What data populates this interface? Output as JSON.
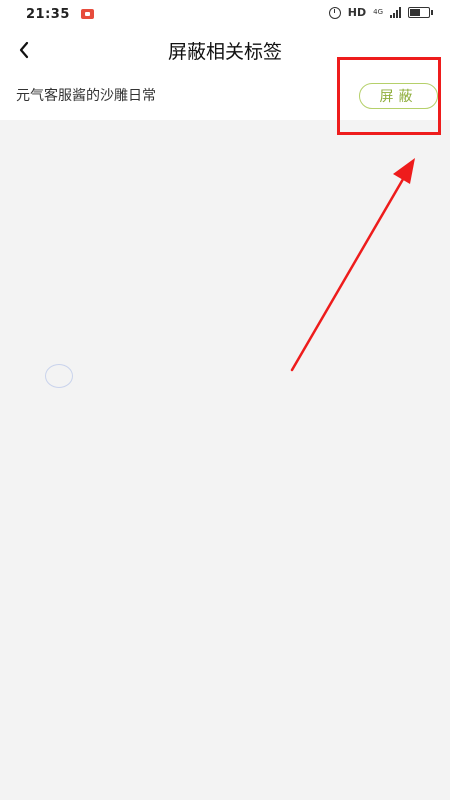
{
  "status_bar": {
    "time": "21:35",
    "hd": "HD",
    "net": "4G"
  },
  "header": {
    "title": "屏蔽相关标签"
  },
  "tag_row": {
    "name": "元气客服酱的沙雕日常",
    "block_label": "屏蔽"
  },
  "colors": {
    "accent_green": "#8fae3c",
    "annotation_red": "#ee1c1c"
  },
  "icons": {
    "back": "chevron-left-icon",
    "alarm": "alarm-icon",
    "signal": "signal-icon",
    "battery": "battery-icon",
    "recording": "screen-record-icon",
    "loading": "loading-spinner"
  }
}
